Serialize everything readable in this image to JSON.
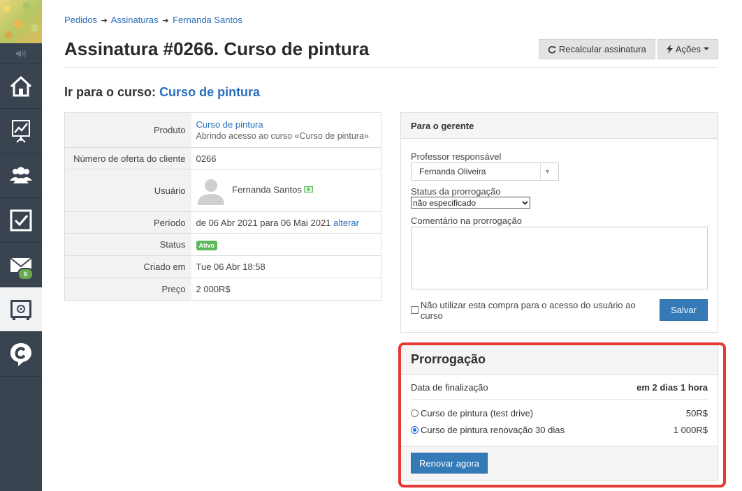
{
  "breadcrumb": {
    "item1": "Pedidos",
    "item2": "Assinaturas",
    "item3": "Fernanda Santos",
    "sep": "➔"
  },
  "page_title": "Assinatura #0266. Curso de pintura",
  "actions": {
    "recalc_label": "Recalcular assinatura",
    "actions_label": "Ações"
  },
  "goto": {
    "prefix": "Ir para o curso:",
    "course_link": "Curso de pintura"
  },
  "info": {
    "product_label": "Produto",
    "product_link": "Curso de pintura",
    "product_desc": "Abrindo acesso ao curso «Curso de pintura»",
    "offer_label": "Número de oferta do cliente",
    "offer_value": "0266",
    "user_label": "Usuário",
    "user_name": "Fernanda Santos",
    "period_label": "Período",
    "period_value": "de 06 Abr 2021 para 06 Mai 2021",
    "period_change": "alterar",
    "status_label": "Status",
    "status_value": "Ativo",
    "created_label": "Criado em",
    "created_value": "Tue 06 Abr 18:58",
    "price_label": "Preço",
    "price_value": "2 000R$"
  },
  "manager": {
    "title": "Para o gerente",
    "teacher_label": "Professor responsável",
    "teacher_value": "Fernanda Oliveira",
    "ext_status_label": "Status da prorrogação",
    "ext_status_value": "não especificado",
    "comment_label": "Comentário na prorrogação",
    "checkbox_label": "Não utilizar esta compra para o acesso do usuário ao curso",
    "save_label": "Salvar"
  },
  "extension": {
    "title": "Prorrogação",
    "end_label": "Data de finalização",
    "end_value": "em 2 dias 1 hora",
    "options": [
      {
        "label": "Curso de pintura (test drive)",
        "price": "50R$",
        "checked": false
      },
      {
        "label": "Curso de pintura renovação 30 dias",
        "price": "1 000R$",
        "checked": true
      }
    ],
    "renew_label": "Renovar agora"
  },
  "sidebar": {
    "mail_badge": "6"
  },
  "colors": {
    "sidebar": "#3a4451",
    "link": "#2a6ebb",
    "primary": "#337ab7",
    "highlight": "#e53935",
    "status_green": "#5cb85c"
  }
}
